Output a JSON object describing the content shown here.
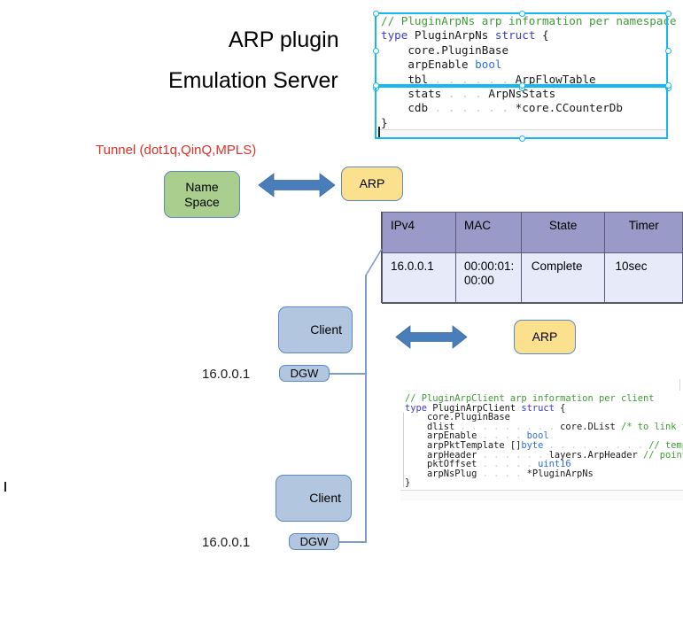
{
  "headings": {
    "line1": "ARP plugin",
    "line2": "Emulation Server"
  },
  "annotations": {
    "tunnel": "Tunnel (dot1q,QinQ,MPLS)",
    "ip_top": "16.0.0.1",
    "ip_bottom": "16.0.0.1"
  },
  "nodes": {
    "namespace": "Name\nSpace",
    "namespace_line1": "Name",
    "namespace_line2": "Space",
    "arp_top": "ARP",
    "arp_mid": "ARP",
    "client_top": "Client",
    "client_bottom": "Client",
    "dgw_top": "DGW",
    "dgw_bottom": "DGW"
  },
  "colors": {
    "namespace_fill": "#a9ce8e",
    "arp_fill": "#fbe18e",
    "client_fill": "#b3c6e0",
    "node_border": "#5a89c4",
    "arrow_fill": "#4a7ebb",
    "tunnel_text": "#e03128",
    "table_header_fill": "#9a9ac8",
    "table_row_fill": "#e7eaf8",
    "table_border": "#5b5b7a",
    "selection_border": "#14b9f0",
    "code_comment": "#3f9c35",
    "code_keyword": "#3b3bcd",
    "code_type": "#6a4fd6",
    "code_builtin": "#2f6fe0"
  },
  "arp_table": {
    "headers": [
      "IPv4",
      "MAC",
      "State",
      "Timer"
    ],
    "rows": [
      {
        "ipv4": "16.0.0.1",
        "mac_line1": "00:00:01:",
        "mac_line2": "00:00",
        "state": "Complete",
        "timer": "10sec"
      }
    ]
  },
  "code_namespace": {
    "lines": [
      {
        "segments": [
          {
            "t": "// PluginArpNs arp information per namespace",
            "c": "cm"
          }
        ]
      },
      {
        "segments": [
          {
            "t": "type ",
            "c": "kw"
          },
          {
            "t": "PluginArpNs ",
            "c": "pl"
          },
          {
            "t": "struct",
            "c": "kw"
          },
          {
            "t": " {",
            "c": "pl"
          }
        ]
      },
      {
        "segments": [
          {
            "t": "    core.PluginBase",
            "c": "pl"
          }
        ]
      },
      {
        "segments": [
          {
            "t": "    arpEnable ",
            "c": "pl"
          },
          {
            "t": "bool",
            "c": "bl"
          }
        ]
      },
      {
        "segments": [
          {
            "t": "    tbl",
            "c": "pl"
          },
          {
            "t": " . . . . . . ",
            "c": "dot"
          },
          {
            "t": "ArpFlowTable",
            "c": "pl"
          }
        ]
      },
      {
        "segments": [
          {
            "t": "    stats",
            "c": "pl"
          },
          {
            "t": " . . . ",
            "c": "dot"
          },
          {
            "t": "ArpNsStats",
            "c": "pl"
          }
        ]
      },
      {
        "segments": [
          {
            "t": "    cdb",
            "c": "pl"
          },
          {
            "t": " . . . . . . ",
            "c": "dot"
          },
          {
            "t": "*core.CCounterDb",
            "c": "pl"
          }
        ]
      },
      {
        "segments": [
          {
            "t": "}",
            "c": "pl"
          }
        ]
      }
    ]
  },
  "code_client": {
    "lines": [
      {
        "segments": [
          {
            "t": "// PluginArpClient arp information per client",
            "c": "cm"
          }
        ]
      },
      {
        "segments": [
          {
            "t": "type ",
            "c": "kw"
          },
          {
            "t": "PluginArpClient ",
            "c": "pl"
          },
          {
            "t": "struct",
            "c": "kw"
          },
          {
            "t": " {",
            "c": "pl"
          }
        ]
      },
      {
        "segments": [
          {
            "t": "    core.PluginBase",
            "c": "pl"
          }
        ]
      },
      {
        "segments": [
          {
            "t": "    dlist",
            "c": "pl"
          },
          {
            "t": " . . . . . . . . . ",
            "c": "dot"
          },
          {
            "t": "core.DList ",
            "c": "pl"
          },
          {
            "t": "/* to link to ArpFlow */",
            "c": "cm"
          }
        ]
      },
      {
        "segments": [
          {
            "t": "    arpEnable",
            "c": "pl"
          },
          {
            "t": " . . . . ",
            "c": "dot"
          },
          {
            "t": "bool",
            "c": "bl"
          }
        ]
      },
      {
        "segments": [
          {
            "t": "    arpPktTemplate []",
            "c": "pl"
          },
          {
            "t": "byte",
            "c": "bl"
          },
          {
            "t": " . . . . . . . . . ",
            "c": "dot"
          },
          {
            "t": "// template packet with",
            "c": "cm"
          }
        ]
      },
      {
        "segments": [
          {
            "t": "    arpHeader",
            "c": "pl"
          },
          {
            "t": " . . . . . . ",
            "c": "dot"
          },
          {
            "t": "layers.ArpHeader ",
            "c": "pl"
          },
          {
            "t": "// point to template packet",
            "c": "cm"
          }
        ]
      },
      {
        "segments": [
          {
            "t": "    pktOffset",
            "c": "pl"
          },
          {
            "t": " . . . . . ",
            "c": "dot"
          },
          {
            "t": "uint16",
            "c": "bl"
          }
        ]
      },
      {
        "segments": [
          {
            "t": "    arpNsPlug",
            "c": "pl"
          },
          {
            "t": " . . . . ",
            "c": "dot"
          },
          {
            "t": "*PluginArpNs",
            "c": "pl"
          }
        ]
      },
      {
        "segments": [
          {
            "t": "}",
            "c": "pl"
          }
        ]
      }
    ]
  }
}
